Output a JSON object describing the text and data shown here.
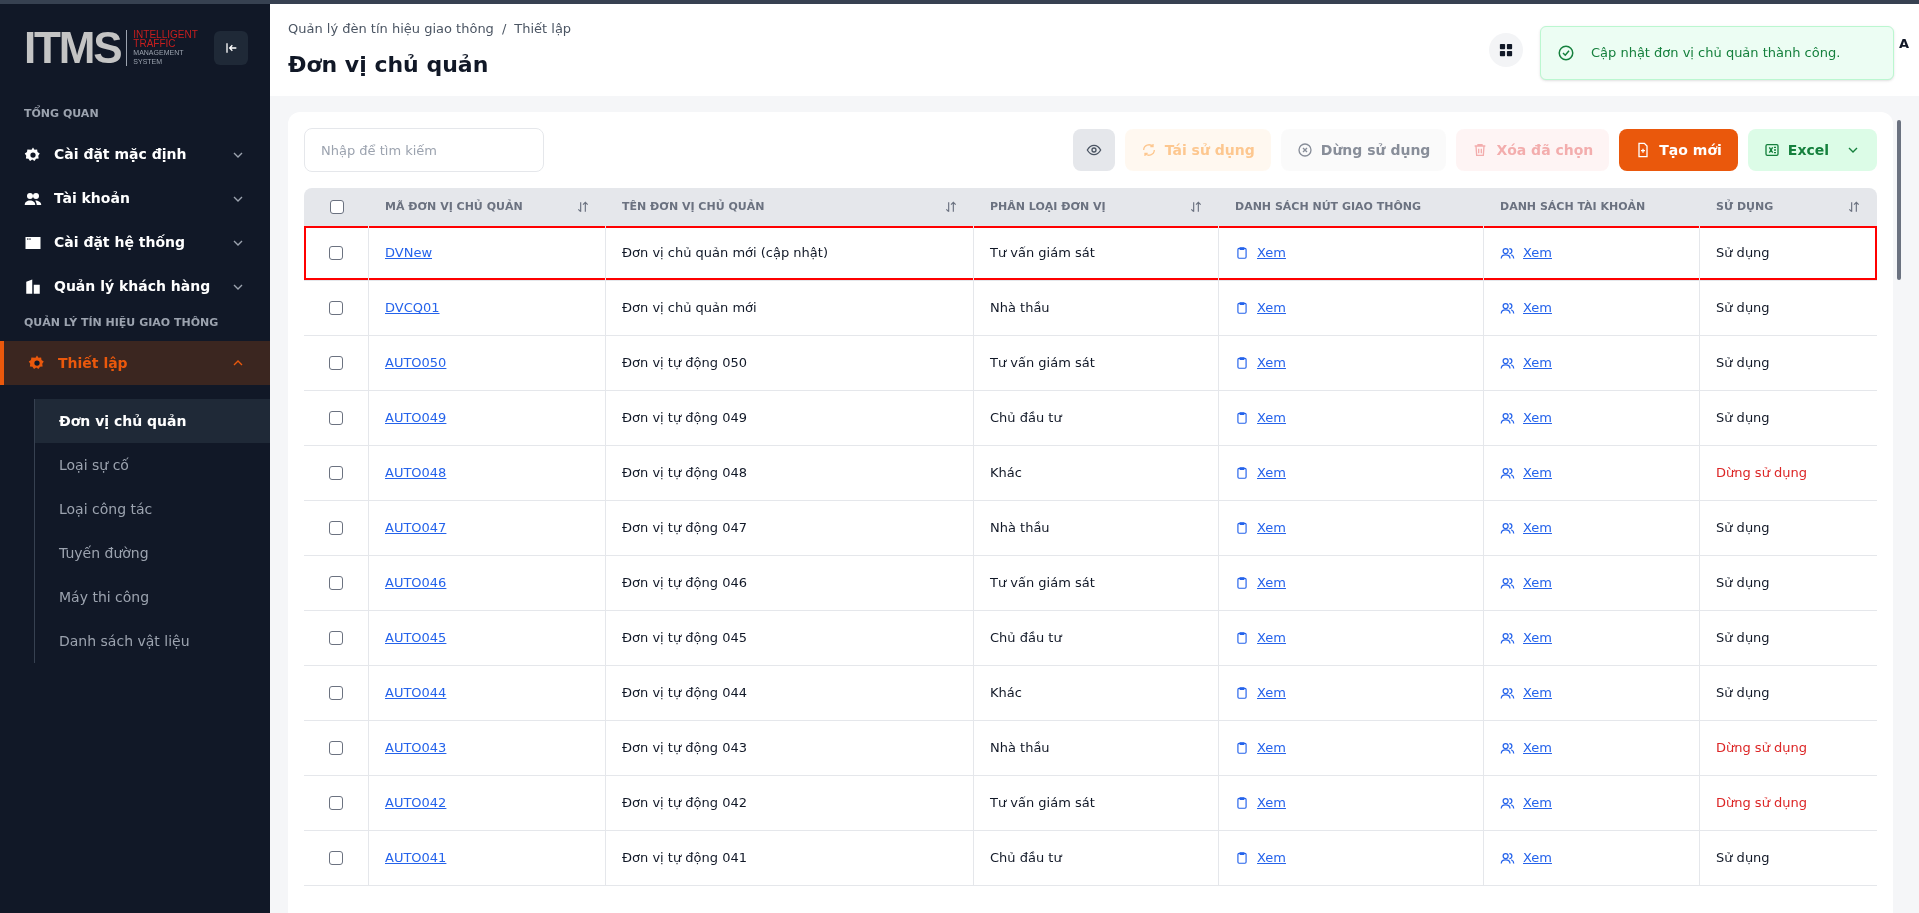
{
  "sidebar": {
    "logo": {
      "mark": "ITMS",
      "lines": [
        "INTELLIGENT",
        "TRAFFIC",
        "MANAGEMENT",
        "SYSTEM"
      ]
    },
    "sections": [
      {
        "title": "TỔNG QUAN",
        "items": [
          {
            "label": "Cài đặt mặc định",
            "kind": "gear",
            "expanded": false,
            "selected": false
          },
          {
            "label": "Tài khoản",
            "kind": "users",
            "expanded": false,
            "selected": false
          },
          {
            "label": "Cài đặt hệ thống",
            "kind": "window",
            "expanded": false,
            "selected": false
          },
          {
            "label": "Quản lý khách hàng",
            "kind": "building",
            "expanded": false,
            "selected": false
          }
        ]
      },
      {
        "title": "QUẢN LÝ TÍN HIỆU GIAO THÔNG",
        "items": [
          {
            "label": "Thiết lập",
            "kind": "gear",
            "expanded": true,
            "selected": true,
            "children": [
              {
                "label": "Đơn vị chủ quản",
                "selected": true
              },
              {
                "label": "Loại sự cố",
                "selected": false
              },
              {
                "label": "Loại công tác",
                "selected": false
              },
              {
                "label": "Tuyến đường",
                "selected": false
              },
              {
                "label": "Máy thi công",
                "selected": false
              },
              {
                "label": "Danh sách vật liệu",
                "selected": false
              }
            ]
          }
        ]
      }
    ]
  },
  "header": {
    "breadcrumb": [
      "Quản lý đèn tín hiệu giao thông",
      "Thiết lập"
    ],
    "separator": "/",
    "title": "Đơn vị chủ quản",
    "user_fragment": "A"
  },
  "toast": {
    "message": "Cập nhật đơn vị chủ quản thành công."
  },
  "toolbar": {
    "search": {
      "placeholder": "Nhập để tìm kiếm"
    },
    "buttons": [
      {
        "kind": "view"
      },
      {
        "kind": "reuse",
        "label": "Tái sử dụng",
        "disabled": true
      },
      {
        "kind": "stop",
        "label": "Dừng sử dụng",
        "disabled": true
      },
      {
        "kind": "delete",
        "label": "Xóa đã chọn",
        "disabled": true
      },
      {
        "kind": "create",
        "label": "Tạo mới",
        "disabled": false
      },
      {
        "kind": "excel",
        "label": "Excel",
        "disabled": false
      }
    ]
  },
  "table": {
    "select_all_checked": false,
    "columns": [
      {
        "label": "MÃ ĐƠN VỊ CHỦ QUẢN",
        "sortable": true
      },
      {
        "label": "TÊN ĐƠN VỊ CHỦ QUẢN",
        "sortable": true
      },
      {
        "label": "PHÂN LOẠI ĐƠN VỊ",
        "sortable": true
      },
      {
        "label": "DANH SÁCH NÚT GIAO THÔNG",
        "sortable": false
      },
      {
        "label": "DANH SÁCH TÀI KHOẢN",
        "sortable": false
      },
      {
        "label": "SỬ DỤNG",
        "sortable": true
      }
    ],
    "rows": [
      {
        "code": "DVNew",
        "name": "Đơn vị chủ quản mới (cập nhật)",
        "type": "Tư vấn giám sát",
        "nodes": "Xem",
        "accounts": "Xem",
        "status": "Sử dụng",
        "active": true,
        "checked": false,
        "highlighted": true
      },
      {
        "code": "DVCQ01",
        "name": "Đơn vị chủ quản mới",
        "type": "Nhà thầu",
        "nodes": "Xem",
        "accounts": "Xem",
        "status": "Sử dụng",
        "active": true,
        "checked": false,
        "highlighted": false
      },
      {
        "code": "AUTO050",
        "name": "Đơn vị tự động 050",
        "type": "Tư vấn giám sát",
        "nodes": "Xem",
        "accounts": "Xem",
        "status": "Sử dụng",
        "active": true,
        "checked": false,
        "highlighted": false
      },
      {
        "code": "AUTO049",
        "name": "Đơn vị tự động 049",
        "type": "Chủ đầu tư",
        "nodes": "Xem",
        "accounts": "Xem",
        "status": "Sử dụng",
        "active": true,
        "checked": false,
        "highlighted": false
      },
      {
        "code": "AUTO048",
        "name": "Đơn vị tự động 048",
        "type": "Khác",
        "nodes": "Xem",
        "accounts": "Xem",
        "status": "Dừng sử dụng",
        "active": false,
        "checked": false,
        "highlighted": false
      },
      {
        "code": "AUTO047",
        "name": "Đơn vị tự động 047",
        "type": "Nhà thầu",
        "nodes": "Xem",
        "accounts": "Xem",
        "status": "Sử dụng",
        "active": true,
        "checked": false,
        "highlighted": false
      },
      {
        "code": "AUTO046",
        "name": "Đơn vị tự động 046",
        "type": "Tư vấn giám sát",
        "nodes": "Xem",
        "accounts": "Xem",
        "status": "Sử dụng",
        "active": true,
        "checked": false,
        "highlighted": false
      },
      {
        "code": "AUTO045",
        "name": "Đơn vị tự động 045",
        "type": "Chủ đầu tư",
        "nodes": "Xem",
        "accounts": "Xem",
        "status": "Sử dụng",
        "active": true,
        "checked": false,
        "highlighted": false
      },
      {
        "code": "AUTO044",
        "name": "Đơn vị tự động 044",
        "type": "Khác",
        "nodes": "Xem",
        "accounts": "Xem",
        "status": "Sử dụng",
        "active": true,
        "checked": false,
        "highlighted": false
      },
      {
        "code": "AUTO043",
        "name": "Đơn vị tự động 043",
        "type": "Nhà thầu",
        "nodes": "Xem",
        "accounts": "Xem",
        "status": "Dừng sử dụng",
        "active": false,
        "checked": false,
        "highlighted": false
      },
      {
        "code": "AUTO042",
        "name": "Đơn vị tự động 042",
        "type": "Tư vấn giám sát",
        "nodes": "Xem",
        "accounts": "Xem",
        "status": "Dừng sử dụng",
        "active": false,
        "checked": false,
        "highlighted": false
      },
      {
        "code": "AUTO041",
        "name": "Đơn vị tự động 041",
        "type": "Chủ đầu tư",
        "nodes": "Xem",
        "accounts": "Xem",
        "status": "Sử dụng",
        "active": true,
        "checked": false,
        "highlighted": false
      }
    ]
  }
}
